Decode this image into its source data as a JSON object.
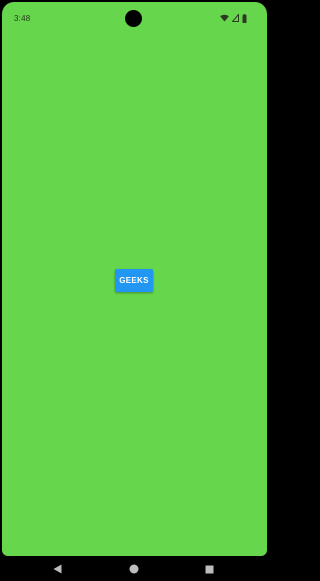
{
  "status_bar": {
    "time": "3:48",
    "icons": [
      "wifi-icon",
      "cellular-signal-icon",
      "battery-icon"
    ]
  },
  "main": {
    "button_label": "GEEKS"
  },
  "nav_bar": {
    "icons": [
      "back-triangle-icon",
      "home-circle-icon",
      "recents-square-icon"
    ]
  },
  "colors": {
    "screen_background": "#66d64c",
    "button_background": "#2196f3",
    "button_text": "#ffffff",
    "status_text": "#2b3a21",
    "frame": "#000000",
    "nav_icons": "#bdbdbd"
  }
}
